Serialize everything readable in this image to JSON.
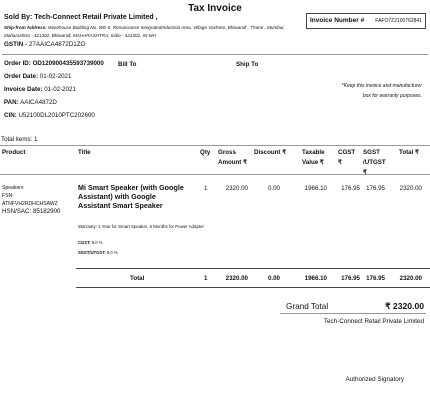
{
  "header": {
    "title": "Tax Invoice",
    "sold_by": "Sold By: Tech-Connect Retail Private Limited ,",
    "ship_from_label": "Ship-from Address:",
    "ship_from_address": "Warehouse Building No. WE-II, Renaissance IntegratedIndustrial Area, Village Vashere, Bhiwandi , Thane , Mumbai, Maharashtra - 421302, Bhiwandi, MAHARASHTRA, India - 421302, IN-MH",
    "gstin_label": "GSTIN -",
    "gstin_value": "27AAICA4872D1ZO",
    "invoice_number_label": "Invoice Number #",
    "invoice_number_value": "FAFO7Z2100762841"
  },
  "order": {
    "order_id_label": "Order ID:",
    "order_id_value": "OD120900435593739000",
    "bill_to_label": "Bill To",
    "ship_to_label": "Ship To",
    "order_date_label": "Order Date:",
    "order_date_value": "01-02-2021",
    "invoice_date_label": "Invoice Date:",
    "invoice_date_value": "01-02-2021",
    "pan_label": "PAN:",
    "pan_value": "AAICA4872D",
    "cin_label": "CIN:",
    "cin_value": "U52100DL2010PTC202600",
    "keep_note": "*Keep this invoice and manufacturer box for warranty purposes."
  },
  "table": {
    "total_items": "Total items: 1",
    "headers": {
      "product": "Product",
      "title": "Title",
      "qty": "Qty",
      "gross": "Gross Amount ₹",
      "discount": "Discount ₹",
      "taxable": "Taxable Value ₹",
      "cgst": "CGST ₹",
      "sgst": "SGST /UTGST ₹",
      "total": "Total ₹"
    },
    "row": {
      "product": "Speakers",
      "fsn_label": "FSN:",
      "fsn_value": "ATNFVH2RDHCHSAWZ",
      "hsn": "HSN/SAC: 85182900",
      "title": "Mi Smart Speaker (with Google Assistant) with Google Assistant Smart Speaker",
      "warranty": "Warranty: 1 Year for Smart Speaker, 6 Months for Power Adapter",
      "cgst_label": "CGST:",
      "cgst_rate": "9.0 %",
      "sgst_label": "SGST/UTGST:",
      "sgst_rate": "9.0 %",
      "qty": "1",
      "gross": "2320.00",
      "discount": "0.00",
      "taxable": "1966.10",
      "cgst": "176.95",
      "sgst": "176.95",
      "total": "2320.00"
    },
    "totals": {
      "label": "Total",
      "qty": "1",
      "gross": "2320.00",
      "discount": "0.00",
      "taxable": "1966.10",
      "cgst": "176.95",
      "sgst": "176.95",
      "total": "2320.00"
    }
  },
  "footer": {
    "grand_total_label": "Grand Total",
    "grand_total_value": "₹ 2320.00",
    "seller_name": "Tech-Connect Retail Private Limited",
    "authorized": "Authorized Signatory"
  }
}
